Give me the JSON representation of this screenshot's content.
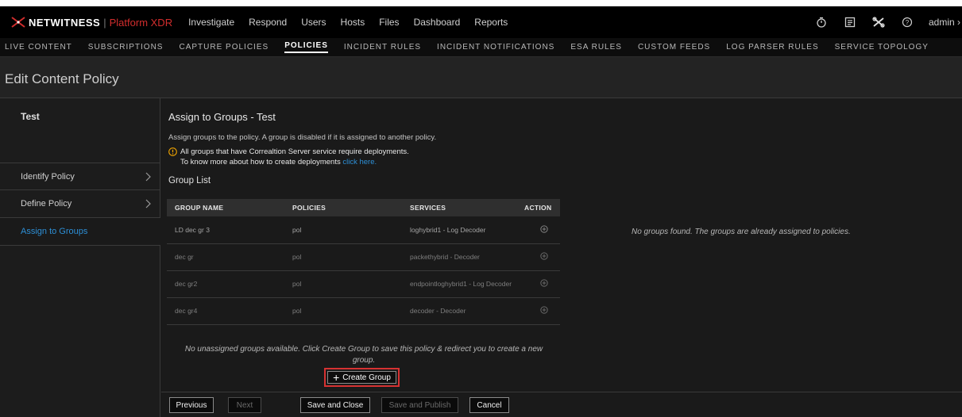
{
  "brand": {
    "name": "NETWITNESS",
    "product": "Platform XDR",
    "accent": "#d12d2d"
  },
  "main_nav": [
    "Investigate",
    "Respond",
    "Users",
    "Hosts",
    "Files",
    "Dashboard",
    "Reports"
  ],
  "user": {
    "name": "admin",
    "chevron": "›"
  },
  "top_icons": [
    "timer-icon",
    "checklist-icon",
    "tools-icon",
    "help-icon"
  ],
  "sub_nav": {
    "items": [
      "LIVE CONTENT",
      "SUBSCRIPTIONS",
      "CAPTURE POLICIES",
      "POLICIES",
      "INCIDENT RULES",
      "INCIDENT NOTIFICATIONS",
      "ESA RULES",
      "CUSTOM FEEDS",
      "LOG PARSER RULES",
      "SERVICE TOPOLOGY"
    ],
    "active": "POLICIES"
  },
  "page_title": "Edit Content Policy",
  "left_panel": {
    "policy_name": "Test",
    "steps": [
      "Identify Policy",
      "Define Policy",
      "Assign to Groups"
    ],
    "active_step": "Assign to Groups",
    "active_color": "#2d8fd6"
  },
  "content": {
    "title": "Assign to Groups - Test",
    "description": "Assign groups to the policy. A group is disabled if it is assigned to another policy.",
    "warning": "All groups that have Correaltion Server service require deployments.",
    "link_prefix": "To know more about how to create deployments",
    "link_text": "click here.",
    "group_list_title": "Group List",
    "table": {
      "headers": [
        "GROUP NAME",
        "POLICIES",
        "SERVICES",
        "ACTION"
      ],
      "rows": [
        [
          "LD dec gr 3",
          "pol",
          "loghybrid1 - Log Decoder"
        ],
        [
          "dec gr",
          "pol",
          "packethybrid - Decoder"
        ],
        [
          "dec gr2",
          "pol",
          "endpointloghybrid1 - Log Decoder"
        ],
        [
          "dec gr4",
          "pol",
          "decoder - Decoder"
        ]
      ]
    },
    "no_unassigned_line1": "No unassigned groups available. Click Create Group to save this policy & redirect you to create a new",
    "no_unassigned_line2": "group.",
    "create_group_label": "Create Group",
    "right_message": "No groups found. The groups are already assigned to policies."
  },
  "footer": {
    "previous": "Previous",
    "next": "Next",
    "save_close": "Save and Close",
    "save_publish": "Save and Publish",
    "cancel": "Cancel"
  }
}
